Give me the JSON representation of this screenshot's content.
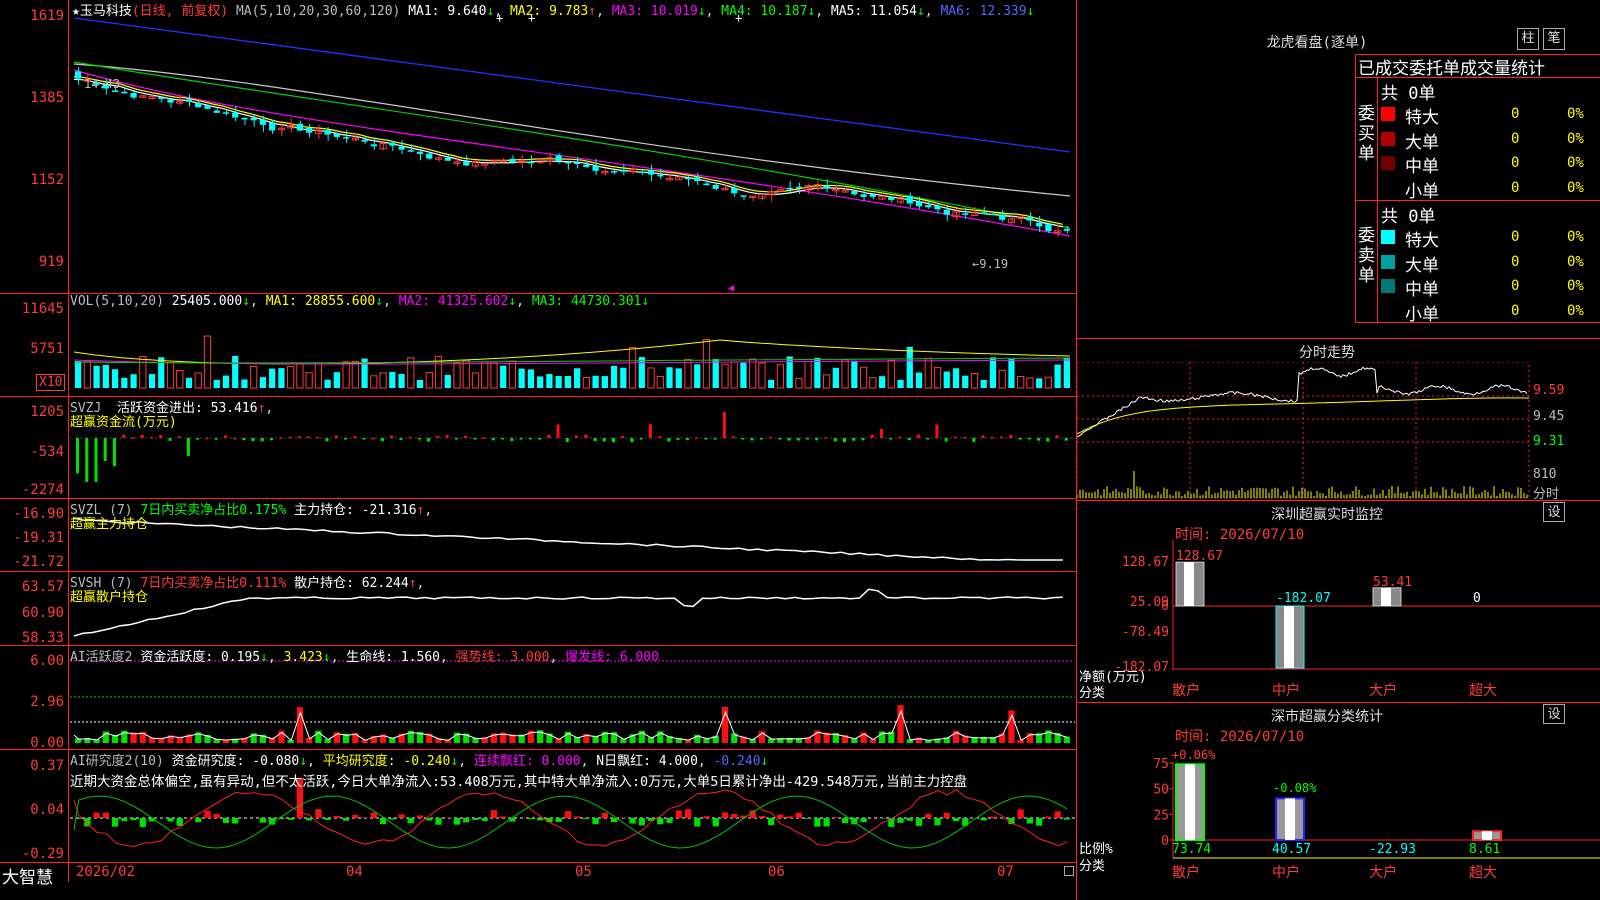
{
  "app": {
    "brand": "大智慧"
  },
  "main_header": {
    "star": "★",
    "stock_name": "玉马科技",
    "period": "(日线, 前复权)",
    "ma_set": "MA(5,10,20,30,60,120)",
    "ma1": "MA1: 9.640",
    "ma2": "MA2: 9.783",
    "ma3": "MA3: 10.019",
    "ma4": "MA4: 10.187",
    "ma5": "MA5: 11.054",
    "ma6": "MA6: 12.339",
    "annot_high": "14.43",
    "annot_low": "9.19"
  },
  "price_axis": [
    "1619",
    "1385",
    "1152",
    "919"
  ],
  "vol_panel": {
    "header": "VOL(5,10,20)",
    "val": "25405.000",
    "ma1": "MA1: 28855.600",
    "ma2": "MA2: 41325.602",
    "ma3": "MA3: 44730.301",
    "axis": [
      "11645",
      "5751"
    ],
    "unit": "X10"
  },
  "svzj_panel": {
    "header": "SVZJ",
    "label": "活跃资金进出: 53.416",
    "sub": "超赢资金流(万元)",
    "axis": [
      "1205",
      "-534",
      "-2274"
    ]
  },
  "svzl_panel": {
    "header": "SVZL (7)",
    "ratio": "7日内买卖净占比0.175%",
    "hold": "主力持仓: -21.316",
    "sub": "超赢主力持仓",
    "axis": [
      "-16.90",
      "-19.31",
      "-21.72"
    ]
  },
  "svsh_panel": {
    "header": "SVSH (7)",
    "ratio": "7日内买卖净占比0.111%",
    "hold": "散户持仓: 62.244",
    "sub": "超赢散户持仓",
    "axis": [
      "63.57",
      "60.90",
      "58.33"
    ]
  },
  "ai_active_panel": {
    "header": "AI活跃度2",
    "val1": "资金活跃度: 0.195",
    "val2": "3.423",
    "life": "生命线: 1.560",
    "strong": "强势线: 3.000",
    "burst": "爆发线: 6.000",
    "axis": [
      "6.00",
      "2.96",
      "0.00"
    ]
  },
  "ai_research_panel": {
    "header": "AI研究度2(10)",
    "val1": "资金研究度: -0.080",
    "val2": "平均研究度: -0.240",
    "val3": "连续飘红: 0.000",
    "val4": "N日飘红: 4.000",
    "val5": "-0.240",
    "comment": "近期大资金总体偏空,虽有异动,但不太活跃,今日大单净流入:53.408万元,其中特大单净流入:0万元,大单5日累计净出-429.548万元,当前主力控盘",
    "axis": [
      "0.37",
      "0.04",
      "-0.29"
    ]
  },
  "time_axis": [
    "2026/02",
    "04",
    "05",
    "06",
    "07"
  ],
  "dragon": {
    "title": "龙虎看盘(逐单)",
    "btn1": "柱",
    "btn2": "笔",
    "header": "已成交委托单成交量统计",
    "buy_label": "委买单",
    "sell_label": "委卖单",
    "buy_total": "共 0单",
    "sell_total": "共 0单",
    "buy_rows": [
      {
        "name": "特大",
        "count": "0",
        "pct": "0%",
        "color": "#ff0000"
      },
      {
        "name": "大单",
        "count": "0",
        "pct": "0%",
        "color": "#b00000"
      },
      {
        "name": "中单",
        "count": "0",
        "pct": "0%",
        "color": "#700000"
      },
      {
        "name": "小单",
        "count": "0",
        "pct": "0%",
        "color": ""
      }
    ],
    "sell_rows": [
      {
        "name": "特大",
        "count": "0",
        "pct": "0%",
        "color": "#00ffff"
      },
      {
        "name": "大单",
        "count": "0",
        "pct": "0%",
        "color": "#00a0a0"
      },
      {
        "name": "中单",
        "count": "0",
        "pct": "0%",
        "color": "#007878"
      },
      {
        "name": "小单",
        "count": "0",
        "pct": "0%",
        "color": ""
      }
    ]
  },
  "intraday": {
    "title": "分时走势",
    "axis": [
      "9.59",
      "9.45",
      "9.31"
    ],
    "vol_top": "810",
    "vol_label": "分时"
  },
  "sz_monitor": {
    "title": "深圳超赢实时监控",
    "btn": "设",
    "time": "时间: 2026/07/10",
    "axis": [
      "128.67",
      "25.09",
      "0",
      "-78.49",
      "-182.07"
    ],
    "y_label": "净额(万元)",
    "x_label": "分类",
    "categories": [
      "散户",
      "中户",
      "大户",
      "超大"
    ],
    "values": [
      128.67,
      -182.07,
      53.41,
      0
    ],
    "value_labels": [
      "128.67",
      "-182.07",
      "53.41",
      "0"
    ]
  },
  "sz_class": {
    "title": "深市超赢分类统计",
    "btn": "设",
    "time": "时间: 2026/07/10",
    "axis": [
      "75",
      "50",
      "25",
      "0"
    ],
    "y_label": "比例%",
    "x_label": "分类",
    "categories": [
      "散户",
      "中户",
      "大户",
      "超大"
    ],
    "values": [
      73.74,
      40.57,
      -22.93,
      8.61
    ],
    "value_labels": [
      "73.74",
      "40.57",
      "-22.93",
      "8.61"
    ],
    "deltas": [
      "+0.06%",
      "-0.08%"
    ]
  }
}
